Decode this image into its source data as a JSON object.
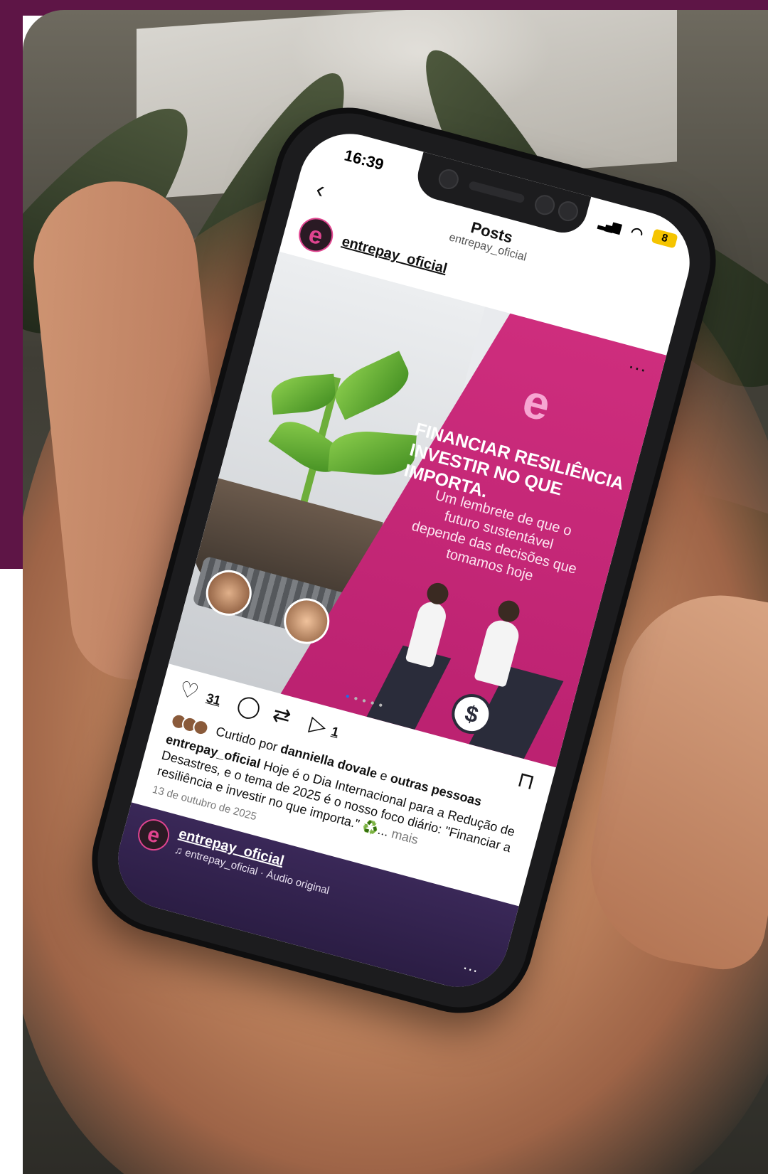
{
  "status": {
    "time": "16:39",
    "signal_icon": "signal-bars-icon",
    "wifi_icon": "wifi-icon",
    "battery": "8"
  },
  "nav": {
    "back_icon": "chevron-left-icon",
    "title": "Posts",
    "subtitle": "entrepay_oficial"
  },
  "author": {
    "avatar_letter": "e",
    "username": "entrepay_oficial"
  },
  "post": {
    "more_icon": "more-options-icon",
    "logo_letter": "e",
    "headline_line1": "FINANCIAR RESILIÊNCIA",
    "headline_line2": "INVESTIR NO QUE IMPORTA.",
    "subline": "Um lembrete de que o futuro sustentável depende das decisões que tomamos hoje",
    "coin_symbol": "$",
    "carousel_total": 5,
    "carousel_active": 1
  },
  "actions": {
    "like_count": "31",
    "send_count": "1"
  },
  "liked_by": {
    "prefix": "Curtido por",
    "user": "danniella dovale",
    "connector": "e",
    "others": "outras pessoas"
  },
  "caption": {
    "user": "entrepay_oficial",
    "text": "Hoje é o Dia Internacional para a Redução de Desastres, e o tema de 2025 é o nosso foco diário: \"Financiar a resiliência e investir no que importa.\" ♻️...",
    "more": "mais",
    "date": "13 de outubro de 2025"
  },
  "bottom": {
    "avatar_letter": "e",
    "user": "entrepay_oficial",
    "audio": "♫ entrepay_oficial · Áudio original"
  },
  "colors": {
    "brand_maroon": "#5e1546",
    "brand_magenta": "#cf2e7e",
    "brand_pink": "#f7a6d2"
  }
}
